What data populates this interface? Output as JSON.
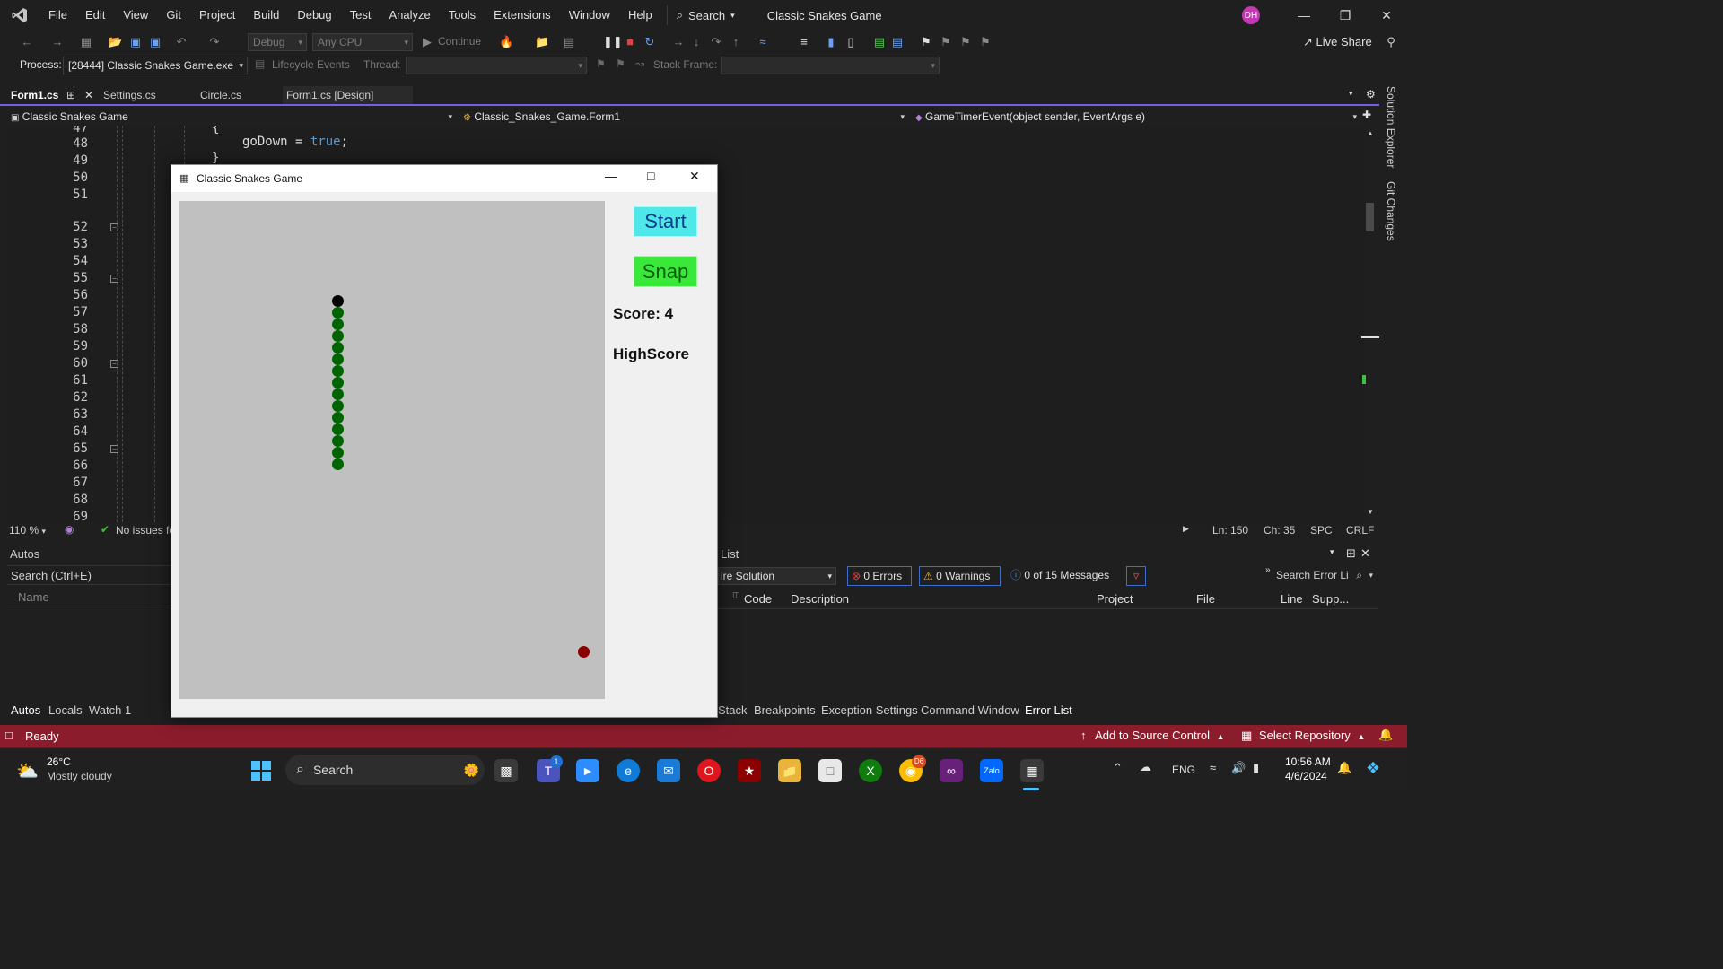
{
  "menubar": {
    "items": [
      "File",
      "Edit",
      "View",
      "Git",
      "Project",
      "Build",
      "Debug",
      "Test",
      "Analyze",
      "Tools",
      "Extensions",
      "Window",
      "Help"
    ],
    "search_label": "Search",
    "window_title": "Classic Snakes Game",
    "avatar_initials": "DH"
  },
  "toolbar": {
    "config": "Debug",
    "platform": "Any CPU",
    "continue_label": "Continue",
    "live_share": "Live Share"
  },
  "debug_location": {
    "process_label": "Process:",
    "process_value": "[28444] Classic Snakes Game.exe",
    "lifecycle_label": "Lifecycle Events",
    "thread_label": "Thread:",
    "stack_frame_label": "Stack Frame:"
  },
  "doc_tabs": [
    {
      "label": "Form1.cs",
      "active": true
    },
    {
      "label": "Settings.cs",
      "active": false
    },
    {
      "label": "Circle.cs",
      "active": false
    },
    {
      "label": "Form1.cs [Design]",
      "active": false
    }
  ],
  "navbar": {
    "project": "Classic Snakes Game",
    "class": "Classic_Snakes_Game.Form1",
    "member": "GameTimerEvent(object sender, EventArgs e)"
  },
  "editor": {
    "line_numbers": [
      "47",
      "48",
      "49",
      "50",
      "51",
      "52",
      "53",
      "54",
      "55",
      "56",
      "57",
      "58",
      "59",
      "60",
      "61",
      "62",
      "63",
      "64",
      "65",
      "66",
      "67",
      "68",
      "69"
    ],
    "code_var": "goDown",
    "code_op": " = ",
    "code_kw": "true",
    "code_end": ";",
    "brace_open": "{",
    "brace_close": "}"
  },
  "editor_status": {
    "zoom": "110 %",
    "issues": "No issues fo",
    "ln": "Ln: 150",
    "ch": "Ch: 35",
    "spc": "SPC",
    "crlf": "CRLF"
  },
  "right_strip": {
    "solution_explorer": "Solution Explorer",
    "git_changes": "Git Changes"
  },
  "autos": {
    "title": "Autos",
    "search_placeholder": "Search (Ctrl+E)",
    "col_name": "Name",
    "tabs": [
      "Autos",
      "Locals",
      "Watch 1"
    ]
  },
  "error_list": {
    "title": "List",
    "scope": "ire Solution",
    "errors": "0 Errors",
    "warnings": "0 Warnings",
    "messages": "0 of 15 Messages",
    "search_placeholder": "Search Error Li",
    "columns": [
      "Code",
      "Description",
      "Project",
      "File",
      "Line",
      "Supp..."
    ],
    "tabs": [
      "Stack",
      "Breakpoints",
      "Exception Settings",
      "Command Window",
      "Error List"
    ]
  },
  "statusbar": {
    "ready": "Ready",
    "add_source": "Add to Source Control",
    "select_repo": "Select Repository",
    "color": "#8b1c2c"
  },
  "taskbar": {
    "weather_temp": "26°C",
    "weather_desc": "Mostly cloudy",
    "search_label": "Search",
    "lang": "ENG",
    "time": "10:56 AM",
    "date": "4/6/2024",
    "teams_badge": "1",
    "chrome_badge": "D6"
  },
  "game_window": {
    "title": "Classic Snakes Game",
    "start_label": "Start",
    "snap_label": "Snap",
    "score_label": "Score: 4",
    "highscore_label": "HighScore",
    "board_color": "#c0c0c0",
    "snake_head_color": "#000000",
    "snake_body_color": "#006400",
    "food_color": "#8b0000"
  }
}
